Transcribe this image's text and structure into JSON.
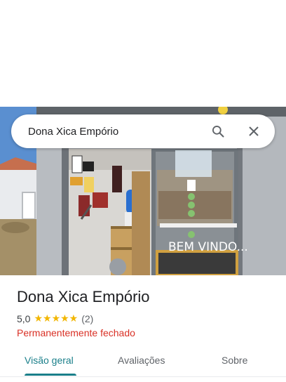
{
  "search": {
    "query": "Dona Xica Empório"
  },
  "place": {
    "name": "Dona Xica Empório",
    "rating": "5,0",
    "stars": "★★★★★",
    "review_count": "(2)",
    "status": "Permanentemente fechado"
  },
  "photo": {
    "storefront_text": "BEM VINDO..."
  },
  "tabs": [
    {
      "label": "Visão geral",
      "active": true
    },
    {
      "label": "Avaliações",
      "active": false
    },
    {
      "label": "Sobre",
      "active": false
    }
  ],
  "colors": {
    "accent": "#1a7f8a",
    "star": "#f2b600",
    "closed": "#d93025"
  }
}
